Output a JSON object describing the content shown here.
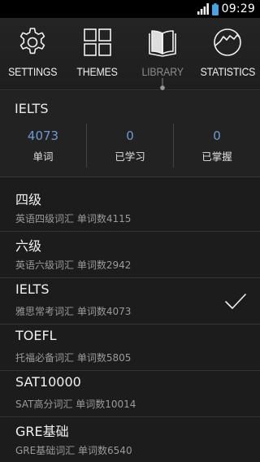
{
  "status_bar": {
    "time": "09:29",
    "icons": [
      "signal-icon",
      "battery-icon"
    ]
  },
  "nav": {
    "items": [
      {
        "label": "SETTINGS",
        "icon": "gear-icon",
        "active": false
      },
      {
        "label": "THEMES",
        "icon": "grid-icon",
        "active": false
      },
      {
        "label": "LIBRARY",
        "icon": "book-icon",
        "active": true
      },
      {
        "label": "STATISTICS",
        "icon": "chart-circle-icon",
        "active": false
      }
    ]
  },
  "current_book": {
    "title": "IELTS",
    "stats": [
      {
        "value": "4073",
        "label": "单词"
      },
      {
        "value": "0",
        "label": "已学习"
      },
      {
        "value": "0",
        "label": "已掌握"
      }
    ]
  },
  "library": {
    "items": [
      {
        "title": "四级",
        "subtitle": "英语四级词汇 单词数4115",
        "selected": false
      },
      {
        "title": "六级",
        "subtitle": "英语六级词汇 单词数2942",
        "selected": false
      },
      {
        "title": "IELTS",
        "subtitle": "雅思常考词汇 单词数4073",
        "selected": true
      },
      {
        "title": "TOEFL",
        "subtitle": "托福必备词汇 单词数5805",
        "selected": false
      },
      {
        "title": "SAT10000",
        "subtitle": "SAT高分词汇 单词数10014",
        "selected": false
      },
      {
        "title": "GRE基础",
        "subtitle": "GRE基础词汇 单词数6540",
        "selected": false
      }
    ]
  },
  "colors": {
    "background": "#1c1c1c",
    "accent": "#6d9ad0",
    "inactive_text": "#8c8c8c"
  }
}
